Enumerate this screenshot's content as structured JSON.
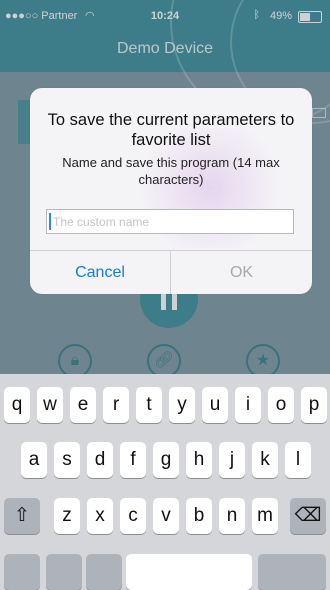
{
  "status_bar": {
    "carrier": "●●●○○ Partner",
    "wifi_icon": "wifi-icon",
    "time": "10:24",
    "bluetooth_icon": "bluetooth-icon",
    "battery": "49%"
  },
  "header": {
    "title": "Demo Device"
  },
  "background_buttons": {
    "pause_icon": "pause-icon",
    "lock_icon": "lock-icon",
    "link_icon": "link-icon",
    "star_icon": "star-icon"
  },
  "dialog": {
    "title": "To save the current parameters to favorite list",
    "message": "Name and save this program (14 max characters)",
    "input_placeholder": "The custom name",
    "input_value": "",
    "cancel_label": "Cancel",
    "ok_label": "OK"
  },
  "keyboard": {
    "row1": [
      "q",
      "w",
      "e",
      "r",
      "t",
      "y",
      "u",
      "i",
      "o",
      "p"
    ],
    "row2": [
      "a",
      "s",
      "d",
      "f",
      "g",
      "h",
      "j",
      "k",
      "l"
    ],
    "row3": [
      "z",
      "x",
      "c",
      "v",
      "b",
      "n",
      "m"
    ],
    "shift_icon": "shift-icon",
    "backspace_icon": "backspace-icon"
  },
  "colors": {
    "accent": "#3d8f9c",
    "button_blue": "#1a7bd6"
  }
}
